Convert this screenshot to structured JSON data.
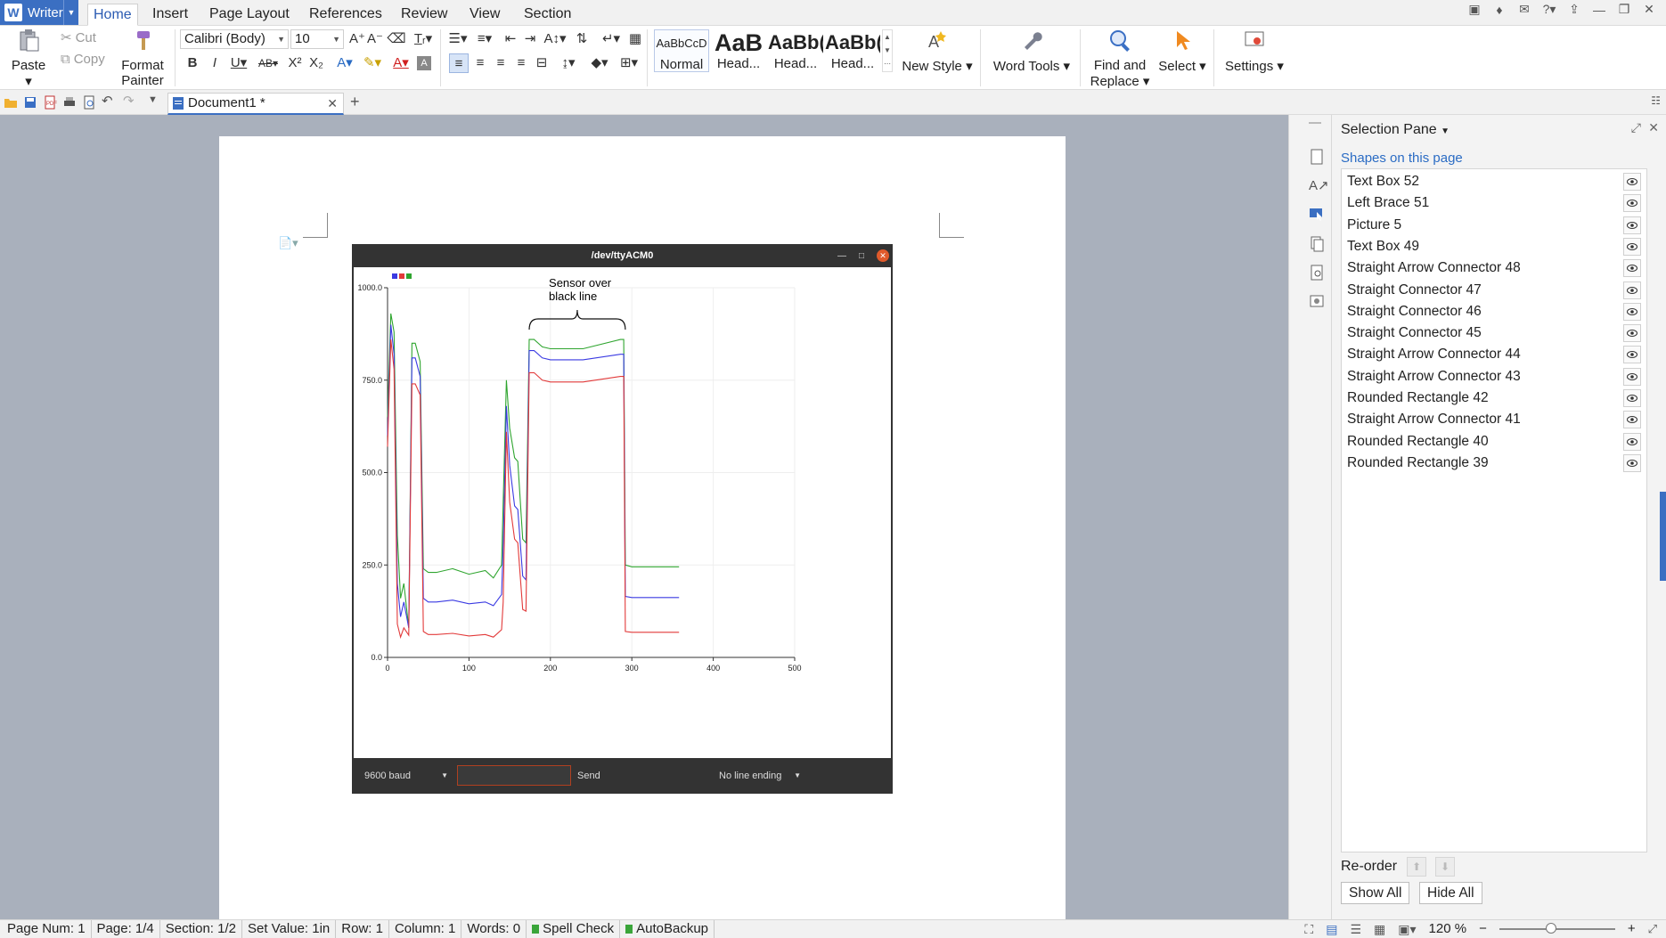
{
  "app": {
    "name": "Writer"
  },
  "menu": {
    "tabs": [
      "Home",
      "Insert",
      "Page Layout",
      "References",
      "Review",
      "View",
      "Section"
    ],
    "active": "Home"
  },
  "ribbon": {
    "paste": "Paste",
    "cut": "Cut",
    "copy": "Copy",
    "format_painter_1": "Format",
    "format_painter_2": "Painter",
    "font_name": "Calibri (Body)",
    "font_size": "10",
    "styles": [
      {
        "preview": "AaBbCcD",
        "label": "Normal"
      },
      {
        "preview": "AaB",
        "label": "Head..."
      },
      {
        "preview": "AaBb(",
        "label": "Head..."
      },
      {
        "preview": "AaBb(",
        "label": "Head..."
      }
    ],
    "new_style": "New Style",
    "word_tools": "Word Tools",
    "find_replace_1": "Find and",
    "find_replace_2": "Replace",
    "select": "Select",
    "settings": "Settings"
  },
  "document_tab": {
    "title": "Document1 *"
  },
  "plot": {
    "window_title": "/dev/ttyACM0",
    "annotation_line1": "Sensor over",
    "annotation_line2": "black line",
    "baud": "9600 baud",
    "send": "Send",
    "line_ending": "No line ending",
    "colors": {
      "series_1": "#e23a3a",
      "series_2": "#3a3ae2",
      "series_3": "#2fa52f"
    }
  },
  "chart_data": {
    "type": "line",
    "title": "",
    "xlabel": "",
    "ylabel": "",
    "xlim": [
      0,
      500
    ],
    "ylim": [
      0,
      1000
    ],
    "xticks": [
      "0",
      "100",
      "200",
      "300",
      "400",
      "500"
    ],
    "yticks": [
      "0.0",
      "250.0",
      "500.0",
      "750.0",
      "1000.0"
    ],
    "legend_position": "top-left",
    "series": [
      {
        "color": "#2fa52f",
        "x": [
          0,
          4,
          8,
          12,
          16,
          20,
          26,
          30,
          34,
          40,
          44,
          50,
          60,
          80,
          100,
          120,
          130,
          140,
          142,
          146,
          150,
          156,
          160,
          166,
          170,
          174,
          180,
          190,
          200,
          240,
          286,
          290,
          292,
          300,
          320,
          358
        ],
        "y": [
          650,
          930,
          880,
          330,
          160,
          200,
          80,
          850,
          850,
          800,
          240,
          230,
          230,
          240,
          225,
          235,
          215,
          250,
          420,
          750,
          620,
          540,
          530,
          320,
          310,
          860,
          860,
          840,
          835,
          835,
          860,
          860,
          250,
          245,
          245,
          245
        ]
      },
      {
        "color": "#3a3ae2",
        "x": [
          0,
          4,
          8,
          12,
          16,
          20,
          26,
          30,
          34,
          40,
          44,
          50,
          60,
          80,
          100,
          120,
          130,
          140,
          142,
          146,
          150,
          156,
          160,
          166,
          170,
          174,
          180,
          190,
          200,
          240,
          286,
          290,
          292,
          300,
          320,
          358
        ],
        "y": [
          600,
          900,
          820,
          200,
          110,
          150,
          80,
          810,
          810,
          760,
          160,
          150,
          150,
          155,
          145,
          150,
          140,
          170,
          300,
          680,
          520,
          410,
          400,
          220,
          210,
          830,
          830,
          810,
          805,
          805,
          820,
          820,
          165,
          162,
          162,
          162
        ]
      },
      {
        "color": "#e23a3a",
        "x": [
          0,
          4,
          8,
          12,
          16,
          20,
          26,
          30,
          34,
          40,
          44,
          50,
          60,
          80,
          100,
          120,
          130,
          140,
          142,
          146,
          150,
          156,
          160,
          166,
          170,
          174,
          180,
          190,
          200,
          240,
          286,
          290,
          292,
          300,
          320,
          358
        ],
        "y": [
          570,
          860,
          780,
          90,
          55,
          80,
          60,
          740,
          740,
          710,
          70,
          62,
          62,
          65,
          58,
          62,
          55,
          75,
          150,
          610,
          420,
          320,
          310,
          130,
          125,
          770,
          770,
          750,
          745,
          745,
          760,
          760,
          70,
          68,
          68,
          68
        ]
      }
    ]
  },
  "selection_pane": {
    "title": "Selection Pane",
    "subtitle": "Shapes on this page",
    "items": [
      "Text Box 52",
      "Left Brace 51",
      "Picture 5",
      "Text Box 49",
      "Straight Arrow Connector 48",
      "Straight Connector 47",
      "Straight Connector 46",
      "Straight Connector 45",
      "Straight Arrow Connector 44",
      "Straight Arrow Connector 43",
      "Rounded Rectangle 42",
      "Straight Arrow Connector 41",
      "Rounded Rectangle 40",
      "Rounded Rectangle 39"
    ],
    "reorder": "Re-order",
    "show_all": "Show All",
    "hide_all": "Hide All"
  },
  "status": {
    "page_num": "Page Num: 1",
    "page": "Page: 1/4",
    "section": "Section: 1/2",
    "set_value": "Set Value: 1in",
    "row": "Row: 1",
    "column": "Column: 1",
    "words": "Words: 0",
    "spell_check": "Spell Check",
    "autobackup": "AutoBackup",
    "zoom": "120 %",
    "zoom_fraction": 0.45
  }
}
